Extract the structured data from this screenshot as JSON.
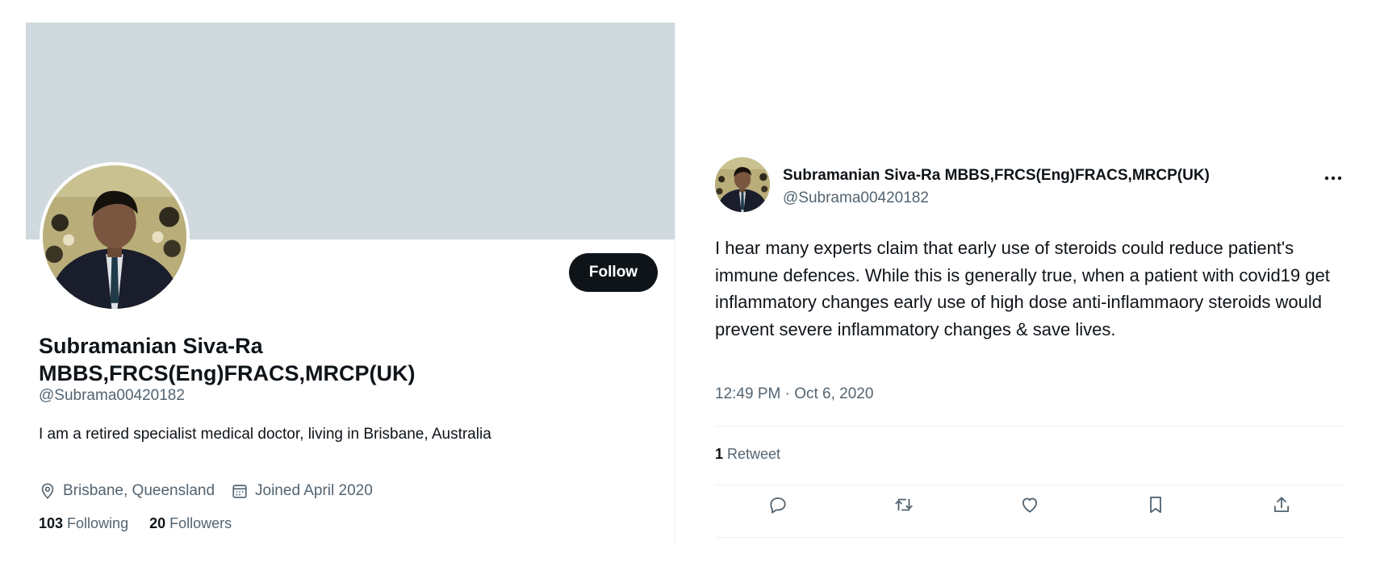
{
  "profile": {
    "display_name": "Subramanian Siva-Ra MBBS,FRCS(Eng)FRACS,MRCP(UK)",
    "handle": "@Subrama00420182",
    "bio": "I am a retired specialist medical doctor, living in Brisbane, Australia",
    "location": "Brisbane, Queensland",
    "joined": "Joined April 2020",
    "following_count": "103",
    "following_label": "Following",
    "followers_count": "20",
    "followers_label": "Followers",
    "follow_label": "Follow",
    "banner_color": "#cfd9de"
  },
  "tweet": {
    "author_name": "Subramanian Siva-Ra MBBS,FRCS(Eng)FRACS,MRCP(UK)",
    "author_handle": "@Subrama00420182",
    "text": "I hear many experts claim that early use of steroids could reduce patient's immune defences. While this is generally true, when a patient with covid19 get inflammatory changes early use of high dose anti-inflammaory steroids would prevent severe inflammatory changes & save lives.",
    "timestamp": "12:49 PM · Oct 6, 2020",
    "retweet_count": "1",
    "retweet_label": "Retweet",
    "actions": [
      "reply-icon",
      "retweet-icon",
      "like-icon",
      "bookmark-icon",
      "share-icon"
    ]
  },
  "colors": {
    "text_primary": "#0f1419",
    "text_secondary": "#536471",
    "divider": "#eff3f4",
    "button_dark": "#0f1419"
  }
}
